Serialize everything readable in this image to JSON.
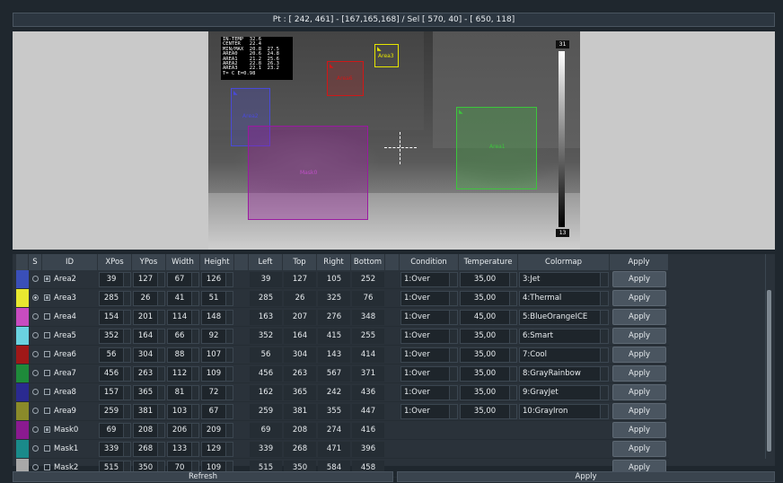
{
  "status_text": "Pt : [ 242, 461] - [167,165,168] / Sel [ 570,  40] - [ 650, 118]",
  "overlay_lines": [
    "IN-TEMP  32.6",
    "CENTER   22.4",
    "MIN/MAX  20.8  27.5",
    "AREA0    20.6  24.8",
    "AREA1    21.2  25.6",
    "AREA2    22.8  26.3",
    "AREA3    22.1  23.2",
    "T= C E=0.98"
  ],
  "scale": {
    "max": "31",
    "min": "13"
  },
  "rois": [
    {
      "name": "Area1",
      "color": "#3cc63c"
    },
    {
      "name": "Area2",
      "color": "#4a4ad8"
    },
    {
      "name": "Area3",
      "color": "#e6e600"
    },
    {
      "name": "Area6",
      "color": "#d01818"
    },
    {
      "name": "Mask0",
      "color": "#9a1aa0"
    }
  ],
  "columns": [
    "S",
    "ID",
    "XPos",
    "YPos",
    "Width",
    "Height",
    "Left",
    "Top",
    "Right",
    "Bottom",
    "Condition",
    "Temperature",
    "Colormap",
    "Apply"
  ],
  "rows": [
    {
      "color": "#3a4fb8",
      "sel": false,
      "checked": true,
      "id": "Area2",
      "x": "39",
      "y": "127",
      "w": "67",
      "h": "126",
      "l": "39",
      "t": "127",
      "r": "105",
      "b": "252",
      "cond": "1:Over",
      "temp": "35,00",
      "cmap": "3:Jet",
      "apply": "Apply"
    },
    {
      "color": "#e8e830",
      "sel": true,
      "checked": true,
      "id": "Area3",
      "x": "285",
      "y": "26",
      "w": "41",
      "h": "51",
      "l": "285",
      "t": "26",
      "r": "325",
      "b": "76",
      "cond": "1:Over",
      "temp": "35,00",
      "cmap": "4:Thermal",
      "apply": "Apply"
    },
    {
      "color": "#c84cc0",
      "sel": false,
      "checked": false,
      "id": "Area4",
      "x": "154",
      "y": "201",
      "w": "114",
      "h": "148",
      "l": "163",
      "t": "207",
      "r": "276",
      "b": "348",
      "cond": "1:Over",
      "temp": "45,00",
      "cmap": "5:BlueOrangeICE",
      "apply": "Apply"
    },
    {
      "color": "#6ad2e0",
      "sel": false,
      "checked": false,
      "id": "Area5",
      "x": "352",
      "y": "164",
      "w": "66",
      "h": "92",
      "l": "352",
      "t": "164",
      "r": "415",
      "b": "255",
      "cond": "1:Over",
      "temp": "35,00",
      "cmap": "6:Smart",
      "apply": "Apply"
    },
    {
      "color": "#a01818",
      "sel": false,
      "checked": false,
      "id": "Area6",
      "x": "56",
      "y": "304",
      "w": "88",
      "h": "107",
      "l": "56",
      "t": "304",
      "r": "143",
      "b": "414",
      "cond": "1:Over",
      "temp": "35,00",
      "cmap": "7:Cool",
      "apply": "Apply"
    },
    {
      "color": "#1e8a3a",
      "sel": false,
      "checked": false,
      "id": "Area7",
      "x": "456",
      "y": "263",
      "w": "112",
      "h": "109",
      "l": "456",
      "t": "263",
      "r": "567",
      "b": "371",
      "cond": "1:Over",
      "temp": "35,00",
      "cmap": "8:GrayRainbow",
      "apply": "Apply"
    },
    {
      "color": "#2a2a90",
      "sel": false,
      "checked": false,
      "id": "Area8",
      "x": "157",
      "y": "365",
      "w": "81",
      "h": "72",
      "l": "162",
      "t": "365",
      "r": "242",
      "b": "436",
      "cond": "1:Over",
      "temp": "35,00",
      "cmap": "9:GrayJet",
      "apply": "Apply"
    },
    {
      "color": "#8a8a2a",
      "sel": false,
      "checked": false,
      "id": "Area9",
      "x": "259",
      "y": "381",
      "w": "103",
      "h": "67",
      "l": "259",
      "t": "381",
      "r": "355",
      "b": "447",
      "cond": "1:Over",
      "temp": "35,00",
      "cmap": "10:GrayIron",
      "apply": "Apply"
    },
    {
      "color": "#8a1a90",
      "sel": false,
      "checked": true,
      "id": "Mask0",
      "x": "69",
      "y": "208",
      "w": "206",
      "h": "209",
      "l": "69",
      "t": "208",
      "r": "274",
      "b": "416",
      "cond": "",
      "temp": "",
      "cmap": "",
      "apply": "Apply"
    },
    {
      "color": "#1a8a8a",
      "sel": false,
      "checked": false,
      "id": "Mask1",
      "x": "339",
      "y": "268",
      "w": "133",
      "h": "129",
      "l": "339",
      "t": "268",
      "r": "471",
      "b": "396",
      "cond": "",
      "temp": "",
      "cmap": "",
      "apply": "Apply"
    },
    {
      "color": "#a8a8a8",
      "sel": false,
      "checked": false,
      "id": "Mask2",
      "x": "515",
      "y": "350",
      "w": "70",
      "h": "109",
      "l": "515",
      "t": "350",
      "r": "584",
      "b": "458",
      "cond": "",
      "temp": "",
      "cmap": "",
      "apply": "Apply"
    }
  ],
  "buttons": {
    "refresh": "Refresh",
    "apply": "Apply"
  }
}
